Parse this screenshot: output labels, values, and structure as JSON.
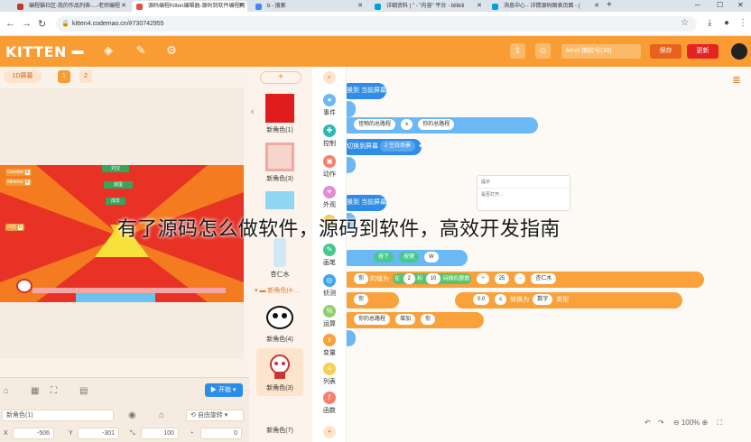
{
  "browser": {
    "tabs": [
      {
        "label": "编程猫社区-我的作品列表-...-老师编程",
        "active": false,
        "color": "#c0392b"
      },
      {
        "label": "源码编程Kitten编辑器-源码到软件编程网",
        "active": true,
        "color": "#e74c3c"
      },
      {
        "label": "b - 搜索",
        "active": false,
        "color": "#4285f4"
      },
      {
        "label": "详细资料 | \" - \"内容\" 平台 - bilibili",
        "active": false,
        "color": "#00a1d6"
      },
      {
        "label": "消息中心 - 详情源码图表页面 - (",
        "active": false,
        "color": "#00a1d6"
      }
    ],
    "url": "kitten4.codemao.cn/#730742955"
  },
  "header": {
    "logo": "KITTEN",
    "work_name": "fenel 捕蚊号(30)",
    "save_label": "保存",
    "update_label": "更新"
  },
  "stage": {
    "screen_label": "1D屏幕",
    "tab1": "1",
    "tab2": "2",
    "vars": [
      {
        "name": "Gnoobe",
        "value": "0"
      },
      {
        "name": "Mintobe",
        "value": "0"
      },
      {
        "name": "闪光",
        "value": "0"
      }
    ],
    "green_labels": [
      "刘汉",
      "成蛋",
      "成长"
    ],
    "run_label": "开始",
    "attr_name": "新角色(1)",
    "rotate_label": "自由旋转",
    "x_label": "X",
    "x_value": "-506",
    "y_label": "Y",
    "y_value": "-301",
    "size_value": "100",
    "angle_value": "0"
  },
  "characters": {
    "add_label": "+",
    "items": [
      {
        "index": "6",
        "name": "新角色(1)",
        "color": "#e11c1c"
      },
      {
        "index": "",
        "name": "新角色(3)",
        "color": "#f2a7a0"
      },
      {
        "index": "",
        "name": "",
        "color": "#8fd6f2"
      },
      {
        "index": "",
        "name": "杏仁水",
        "color": "#cfe8f3"
      }
    ],
    "group_label": "新角色(4-...",
    "group_items": [
      {
        "name": "新角色(4)"
      },
      {
        "name": "新角色(3)"
      },
      {
        "name": "新角色(7)"
      }
    ]
  },
  "categories": [
    {
      "label": "事件",
      "color": "#6ab9f6"
    },
    {
      "label": "控制",
      "color": "#2eb8b8"
    },
    {
      "label": "动作",
      "color": "#f97d6a"
    },
    {
      "label": "外观",
      "color": "#e68ad6"
    },
    {
      "label": "",
      "color": "#f3c84a"
    },
    {
      "label": "画笔",
      "color": "#46c890"
    },
    {
      "label": "侦测",
      "color": "#3aa8f0"
    },
    {
      "label": "运算",
      "color": "#8fd06a"
    },
    {
      "label": "变量",
      "color": "#f9a13a"
    },
    {
      "label": "列表",
      "color": "#f6d04d"
    },
    {
      "label": "函数",
      "color": "#f97d6a"
    }
  ],
  "code": {
    "b1": "换到 当前屏幕",
    "b2_a": "怪物的总路程",
    "b2_op": "≥",
    "b2_b": "你的总路程",
    "b3_a": "切换到屏幕",
    "b3_b": "2 空白场景",
    "b4": "换到 当前屏幕",
    "b5_a": "按下",
    "b5_b": "按键",
    "b5_c": "W",
    "b6_a": "你",
    "b6_b": "的值为",
    "b6_c": "在",
    "b6_d": "2",
    "b6_e": "和",
    "b6_f": "10",
    "b6_g": "间随机整数",
    "b6_h": "÷",
    "b6_i": "25",
    "b6_j": "-",
    "b6_k": "杏仁水",
    "b7_a": "你",
    "b7_b": "0.0",
    "b7_c": "c",
    "b7_d": "转换为",
    "b7_e": "数字",
    "b7_f": "类型",
    "b8_a": "你的总路程",
    "b8_b": "增加",
    "b8_c": "你",
    "dialog_title": "提示",
    "dialog_text": "是否打开...",
    "zoom": "100%"
  },
  "overlay_title": "有了源码怎么做软件，源码到软件，高效开发指南"
}
